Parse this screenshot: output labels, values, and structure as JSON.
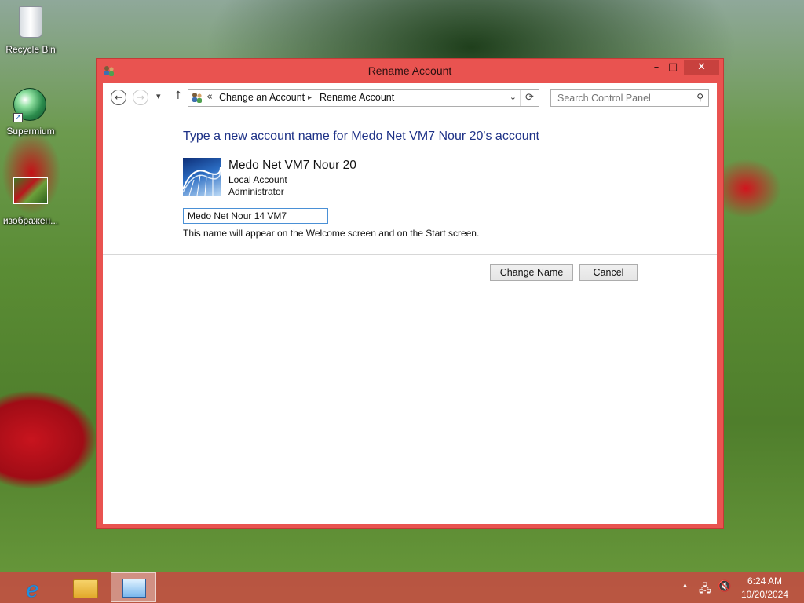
{
  "desktop": {
    "icons": [
      {
        "label": "Recycle Bin",
        "icon": "recycle-bin-icon"
      },
      {
        "label": "Supermium",
        "icon": "supermium-icon"
      },
      {
        "label": "изображен...",
        "icon": "image-file-icon"
      }
    ]
  },
  "window": {
    "title": "Rename Account",
    "controls": {
      "minimize": "–",
      "maximize": "□",
      "close": "✕"
    }
  },
  "nav": {
    "back": "←",
    "forward": "→",
    "recent_dropdown": "▾",
    "up": "↑",
    "breadcrumb_overflow": "«",
    "breadcrumbs": [
      "Change an Account",
      "Rename Account"
    ],
    "crumb_separator": "▸",
    "dropdown": "⌄",
    "refresh": "⟳",
    "search_placeholder": "Search Control Panel",
    "search_icon": "⚲"
  },
  "content": {
    "heading": "Type a new account name for Medo Net VM7 Nour 20's account",
    "account": {
      "name": "Medo Net VM7 Nour 20",
      "type": "Local Account",
      "role": "Administrator"
    },
    "name_field_value": "Medo Net Nour 14 VM7",
    "hint": "This name will appear on the Welcome screen and on the Start screen.",
    "change_button": "Change Name",
    "cancel_button": "Cancel"
  },
  "taskbar": {
    "apps": [
      {
        "name": "Internet Explorer",
        "icon": "internet-explorer-icon",
        "glyph": "e"
      },
      {
        "name": "File Explorer",
        "icon": "file-explorer-icon"
      },
      {
        "name": "Control Panel",
        "icon": "control-panel-icon",
        "active": true
      }
    ],
    "tray": {
      "show_hidden": "▴",
      "network": "🖧",
      "volume": "🔇"
    },
    "time": "6:24 AM",
    "date": "10/20/2024"
  },
  "colors": {
    "window_frame": "#e95350",
    "heading_blue": "#1e3287",
    "taskbar": "#c44c42"
  }
}
